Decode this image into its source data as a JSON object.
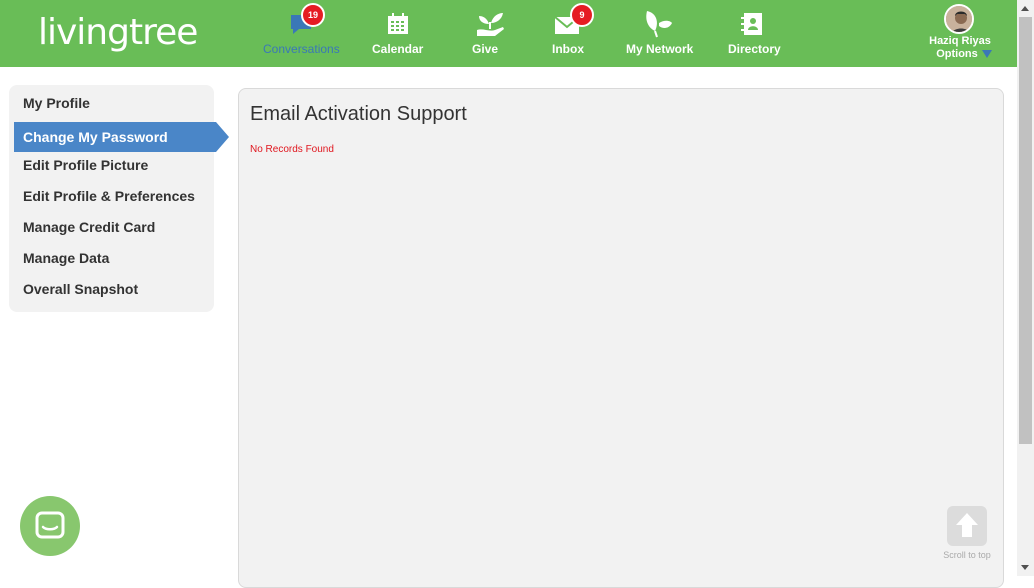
{
  "brand": {
    "logo_text": "livingtree"
  },
  "nav": {
    "items": [
      {
        "label": "Conversations",
        "icon": "chat-bubble-icon",
        "badge": "19",
        "active": true
      },
      {
        "label": "Calendar",
        "icon": "calendar-icon",
        "badge": null
      },
      {
        "label": "Give",
        "icon": "hand-plant-icon",
        "badge": null
      },
      {
        "label": "Inbox",
        "icon": "envelope-icon",
        "badge": "9"
      },
      {
        "label": "My Network",
        "icon": "leaf-network-icon",
        "badge": null
      },
      {
        "label": "Directory",
        "icon": "contact-book-icon",
        "badge": null
      }
    ]
  },
  "user": {
    "name": "Haziq Riyas",
    "options_label": "Options"
  },
  "sidebar": {
    "items": [
      {
        "label": "My Profile"
      },
      {
        "label": "Change My Password",
        "active": true
      },
      {
        "label": "Edit Profile Picture"
      },
      {
        "label": "Edit Profile & Preferences"
      },
      {
        "label": "Manage Credit Card"
      },
      {
        "label": "Manage Data"
      },
      {
        "label": "Overall Snapshot"
      }
    ]
  },
  "main": {
    "title": "Email Activation Support",
    "empty_message": "No Records Found"
  },
  "scroll_top": {
    "label": "Scroll to top",
    "icon": "arrow-up-icon"
  },
  "chat": {
    "icon": "chat-widget-icon"
  },
  "colors": {
    "header_green": "#69bd57",
    "active_blue": "#4a86c8",
    "badge_red": "#e51c23",
    "error_red": "#e0161e",
    "panel_gray": "#f2f2f2"
  }
}
